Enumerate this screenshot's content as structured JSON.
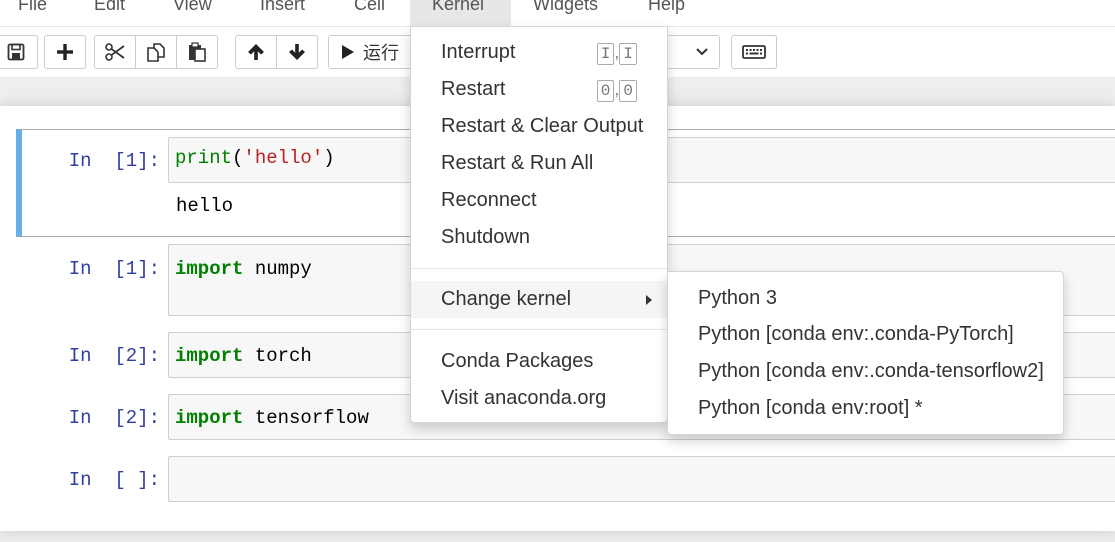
{
  "menubar": {
    "items": [
      {
        "label": "File"
      },
      {
        "label": "Edit"
      },
      {
        "label": "View"
      },
      {
        "label": "Insert"
      },
      {
        "label": "Cell"
      },
      {
        "label": "Kernel"
      },
      {
        "label": "Widgets"
      },
      {
        "label": "Help"
      }
    ],
    "active": "Kernel"
  },
  "toolbar": {
    "run_label": "运行",
    "icons": [
      "save-icon",
      "plus-icon",
      "cut-icon",
      "copy-icon",
      "paste-icon",
      "arrow-up-icon",
      "arrow-down-icon",
      "play-icon",
      "keyboard-icon"
    ]
  },
  "kernel_menu": {
    "items": [
      {
        "label": "Interrupt",
        "shortcut": [
          "I",
          "I"
        ]
      },
      {
        "label": "Restart",
        "shortcut": [
          "0",
          "0"
        ]
      },
      {
        "label": "Restart & Clear Output"
      },
      {
        "label": "Restart & Run All"
      },
      {
        "label": "Reconnect"
      },
      {
        "label": "Shutdown"
      },
      {
        "label": "Change kernel"
      },
      {
        "label": "Conda Packages"
      },
      {
        "label": "Visit anaconda.org"
      }
    ],
    "shortcut_sep": ","
  },
  "change_kernel_submenu": {
    "items": [
      {
        "label": "Python 3"
      },
      {
        "label": "Python [conda env:.conda-PyTorch]"
      },
      {
        "label": "Python [conda env:.conda-tensorflow2]"
      },
      {
        "label": "Python [conda env:root] *"
      }
    ]
  },
  "cells": [
    {
      "prompt": "In  [1]:",
      "code_fn": "print",
      "code_open": "(",
      "code_str": "'hello'",
      "code_close": ")",
      "output": "hello"
    },
    {
      "prompt": "In  [1]:",
      "code_kw": "import",
      "code_rest": " numpy"
    },
    {
      "prompt": "In  [2]:",
      "code_kw": "import",
      "code_rest": " torch"
    },
    {
      "prompt": "In  [2]:",
      "code_kw": "import",
      "code_rest": " tensorflow"
    },
    {
      "prompt": "In  [ ]:"
    }
  ],
  "colors": {
    "selected_cell_bar": "#66afe9",
    "prompt": "#303f9f",
    "keyword": "#008000",
    "string": "#ba2121"
  }
}
